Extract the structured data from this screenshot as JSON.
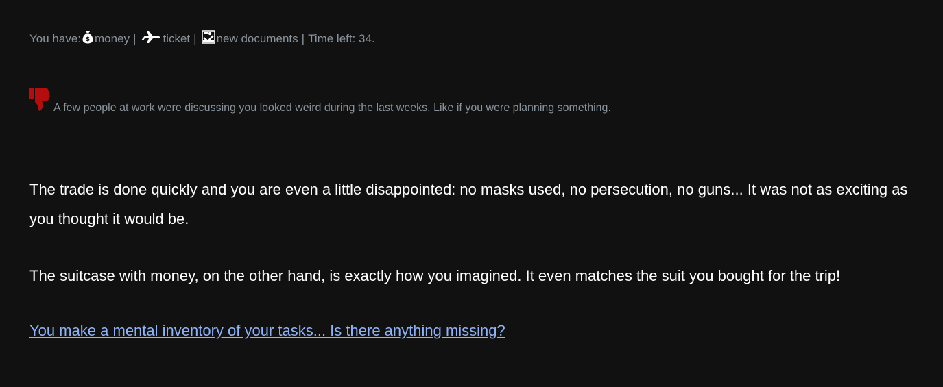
{
  "status": {
    "prefix": "You have:",
    "money_label": "money",
    "ticket_label": "ticket",
    "documents_label": "new documents",
    "separator": "|",
    "time_left": "Time left: 34."
  },
  "notice": {
    "icon": "thumbs-down-icon",
    "icon_color": "#b50d0d",
    "text": "A few people at work were discussing you looked weird during the last weeks. Like if you were planning something."
  },
  "story": {
    "paragraphs": [
      "The trade is done quickly and you are even a little disappointed: no masks used, no persecution, no guns... It was not as exciting as you thought it would be.",
      "The suitcase with money, on the other hand, is exactly how you imagined. It even matches the suit you bought for the trip!"
    ]
  },
  "choice": {
    "label": "You make a mental inventory of your tasks... Is there anything missing?"
  },
  "colors": {
    "background": "#111111",
    "muted_text": "#8a939c",
    "link": "#8fb2f8"
  }
}
